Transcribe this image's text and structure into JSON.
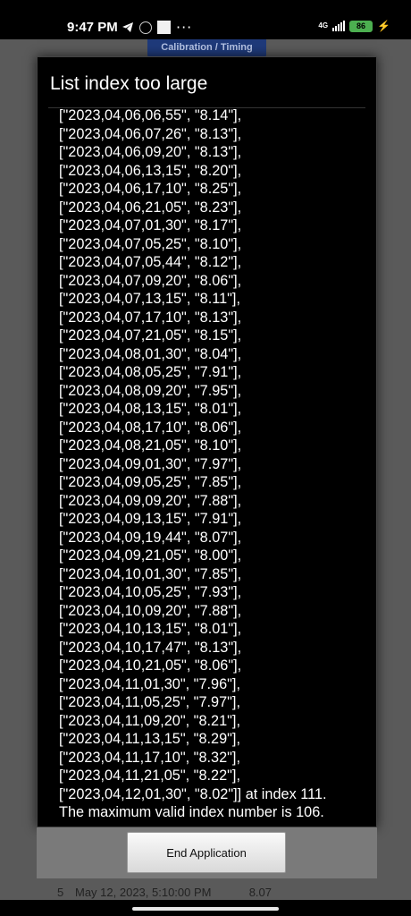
{
  "status_bar": {
    "time": "9:47 PM",
    "icons_left": [
      "telegram-icon",
      "notification-badge-icon",
      "white-square-icon",
      "more-dots-icon"
    ],
    "dots": "···",
    "network": "4G",
    "battery": "86",
    "icons_right": [
      "signal-icon",
      "battery-icon",
      "charging-icon"
    ]
  },
  "background_app": {
    "button_label": "Calibration / Timing",
    "row": {
      "index": "5",
      "date": "May 12, 2023, 5:10:00 PM",
      "value": "8.07"
    }
  },
  "dialog": {
    "title": "List index too large",
    "message_lines": [
      "[\"2023,04,06,06,55\", \"8.14\"],",
      "[\"2023,04,06,07,26\", \"8.13\"],",
      "[\"2023,04,06,09,20\", \"8.13\"],",
      "[\"2023,04,06,13,15\", \"8.20\"],",
      "[\"2023,04,06,17,10\", \"8.25\"],",
      "[\"2023,04,06,21,05\", \"8.23\"],",
      "[\"2023,04,07,01,30\", \"8.17\"],",
      "[\"2023,04,07,05,25\", \"8.10\"],",
      "[\"2023,04,07,05,44\", \"8.12\"],",
      "[\"2023,04,07,09,20\", \"8.06\"],",
      "[\"2023,04,07,13,15\", \"8.11\"],",
      "[\"2023,04,07,17,10\", \"8.13\"],",
      "[\"2023,04,07,21,05\", \"8.15\"],",
      "[\"2023,04,08,01,30\", \"8.04\"],",
      "[\"2023,04,08,05,25\", \"7.91\"],",
      "[\"2023,04,08,09,20\", \"7.95\"],",
      "[\"2023,04,08,13,15\", \"8.01\"],",
      "[\"2023,04,08,17,10\", \"8.06\"],",
      "[\"2023,04,08,21,05\", \"8.10\"],",
      "[\"2023,04,09,01,30\", \"7.97\"],",
      "[\"2023,04,09,05,25\", \"7.85\"],",
      "[\"2023,04,09,09,20\", \"7.88\"],",
      "[\"2023,04,09,13,15\", \"7.91\"],",
      "[\"2023,04,09,19,44\", \"8.07\"],",
      "[\"2023,04,09,21,05\", \"8.00\"],",
      "[\"2023,04,10,01,30\", \"7.85\"],",
      "[\"2023,04,10,05,25\", \"7.93\"],",
      "[\"2023,04,10,09,20\", \"7.88\"],",
      "[\"2023,04,10,13,15\", \"8.01\"],",
      "[\"2023,04,10,17,47\", \"8.13\"],",
      "[\"2023,04,10,21,05\", \"8.06\"],",
      "[\"2023,04,11,01,30\", \"7.96\"],",
      "[\"2023,04,11,05,25\", \"7.97\"],",
      "[\"2023,04,11,09,20\", \"8.21\"],",
      "[\"2023,04,11,13,15\", \"8.29\"],",
      "[\"2023,04,11,17,10\", \"8.32\"],",
      "[\"2023,04,11,21,05\", \"8.22\"],",
      "[\"2023,04,12,01,30\", \"8.02\"]] at index 111.",
      "The maximum valid index number is 106."
    ],
    "button_label": "End Application"
  },
  "colors": {
    "dialog_bg": "#000000",
    "dim_overlay": "#5a5a5a",
    "footer_bg": "#7a7a7a",
    "battery": "#4caf50",
    "bg_button": "#1f3a7a"
  }
}
